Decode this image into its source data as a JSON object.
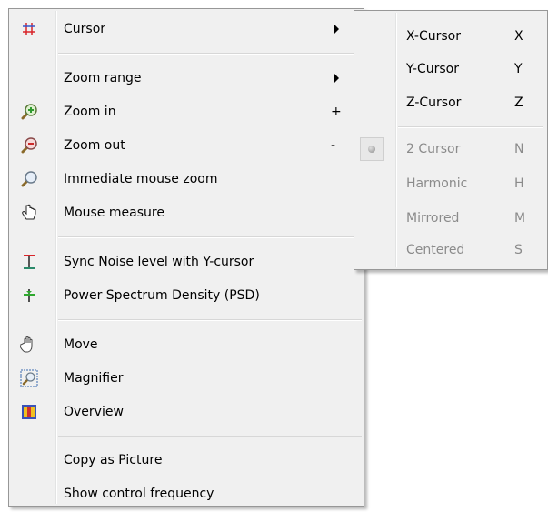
{
  "main_menu": {
    "items": [
      {
        "label": "Cursor",
        "shortcut": "",
        "has_submenu": true,
        "icon": "cursor-crosshair-icon"
      },
      {
        "label": "Zoom range",
        "shortcut": "",
        "has_submenu": true,
        "icon": ""
      },
      {
        "label": "Zoom in",
        "shortcut": "+",
        "icon": "zoom-in-icon"
      },
      {
        "label": "Zoom out",
        "shortcut": "-",
        "icon": "zoom-out-icon"
      },
      {
        "label": "Immediate mouse zoom",
        "shortcut": "",
        "icon": "magnifier-icon"
      },
      {
        "label": "Mouse measure",
        "shortcut": "",
        "icon": "hand-pointer-icon"
      },
      {
        "label": "Sync Noise level with Y-cursor",
        "shortcut": "",
        "icon": "noise-level-icon"
      },
      {
        "label": "Power Spectrum Density (PSD)",
        "shortcut": "",
        "icon": "psd-icon"
      },
      {
        "label": "Move",
        "shortcut": "",
        "icon": "hand-move-icon"
      },
      {
        "label": "Magnifier",
        "shortcut": "",
        "icon": "magnifier-box-icon"
      },
      {
        "label": "Overview",
        "shortcut": "",
        "icon": "overview-icon"
      },
      {
        "label": "Copy as Picture",
        "shortcut": "",
        "icon": ""
      },
      {
        "label": "Show control frequency",
        "shortcut": "",
        "icon": ""
      }
    ]
  },
  "cursor_submenu": {
    "items": [
      {
        "label": "X-Cursor",
        "shortcut": "X",
        "enabled": true
      },
      {
        "label": "Y-Cursor",
        "shortcut": "Y",
        "enabled": true
      },
      {
        "label": "Z-Cursor",
        "shortcut": "Z",
        "enabled": true
      },
      {
        "label": "2 Cursor",
        "shortcut": "N",
        "enabled": false,
        "checked": true
      },
      {
        "label": "Harmonic",
        "shortcut": "H",
        "enabled": false
      },
      {
        "label": "Mirrored",
        "shortcut": "M",
        "enabled": false
      },
      {
        "label": "Centered",
        "shortcut": "S",
        "enabled": false
      }
    ]
  },
  "colors": {
    "menu_bg": "#f0f0f0",
    "disabled_text": "#8b8b8b",
    "border": "#979797"
  }
}
